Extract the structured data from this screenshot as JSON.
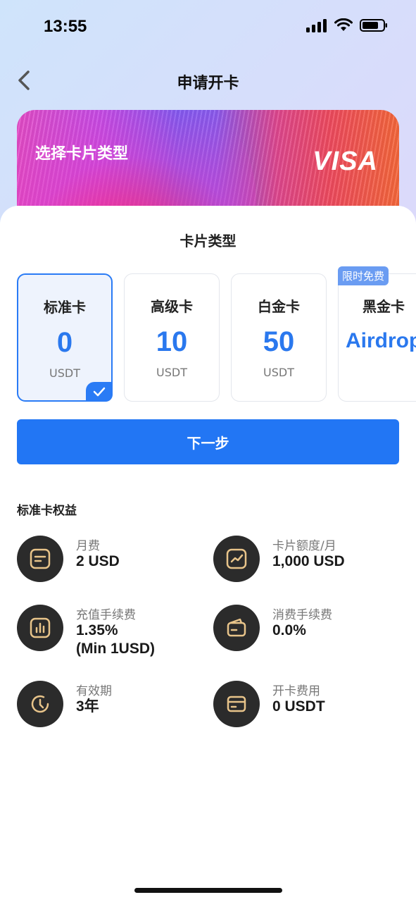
{
  "status_bar": {
    "time": "13:55"
  },
  "nav": {
    "title": "申请开卡"
  },
  "banner": {
    "title": "选择卡片类型",
    "brand": "VISA"
  },
  "card_types": {
    "title": "卡片类型",
    "free_badge": "限时免费",
    "tiers": [
      {
        "name": "标准卡",
        "price": "0",
        "unit": "USDT",
        "selected": true
      },
      {
        "name": "高级卡",
        "price": "10",
        "unit": "USDT"
      },
      {
        "name": "白金卡",
        "price": "50",
        "unit": "USDT"
      },
      {
        "name": "黑金卡",
        "price": "Airdrop"
      }
    ]
  },
  "next_button": {
    "label": "下一步"
  },
  "benefits": {
    "title": "标准卡权益",
    "items": [
      {
        "label": "月费",
        "value": "2 USD",
        "icon": "note-icon"
      },
      {
        "label": "卡片额度/月",
        "value": "1,000 USD",
        "icon": "trend-chart-icon"
      },
      {
        "label": "充值手续费",
        "value": "1.35%\n(Min 1USD)",
        "icon": "bar-chart-icon"
      },
      {
        "label": "消费手续费",
        "value": "0.0%",
        "icon": "wallet-icon"
      },
      {
        "label": "有效期",
        "value": "3年",
        "icon": "clock-icon"
      },
      {
        "label": "开卡费用",
        "value": "0 USDT",
        "icon": "card-icon"
      }
    ]
  },
  "colors": {
    "accent": "#2276f4",
    "gold_icon": "#e8c48a",
    "icon_bg": "#2b2b2b"
  }
}
